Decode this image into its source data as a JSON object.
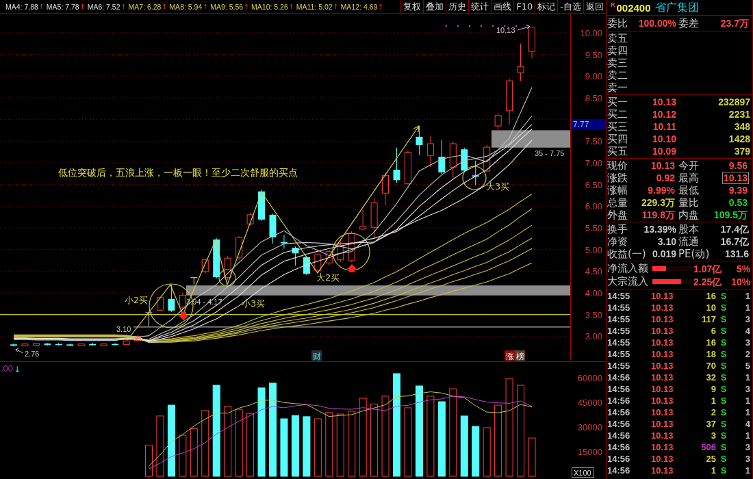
{
  "toolbar": {
    "ma_labels": [
      {
        "label": "MA4: 7.88",
        "arrow": "↑",
        "color": "#e0e0e0"
      },
      {
        "label": "MA5: 7.78",
        "arrow": "↑",
        "color": "#e0e0e0"
      },
      {
        "label": "MA6: 7.52",
        "arrow": "↑",
        "color": "#e0e0e0"
      },
      {
        "label": "MA7: 6.28",
        "arrow": "↑",
        "color": "#dcd44c"
      },
      {
        "label": "MA8: 5.94",
        "arrow": "↑",
        "color": "#dcd44c"
      },
      {
        "label": "MA9: 5.56",
        "arrow": "↑",
        "color": "#dcd44c"
      },
      {
        "label": "MA10: 5.26",
        "arrow": "↑",
        "color": "#dcd44c"
      },
      {
        "label": "MA11: 5.02",
        "arrow": "↑",
        "color": "#dcd44c"
      },
      {
        "label": "MA12: 4.69",
        "arrow": "↑",
        "color": "#dcd44c"
      }
    ],
    "buttons": [
      "复权",
      "叠加",
      "历史",
      "统计",
      "画线",
      "F10",
      "标记",
      "-自选",
      "返回"
    ]
  },
  "price_chart": {
    "price_tag": "7.77",
    "headline": "低位突破后，五浪上涨，一板一眼！至少二次舒服的买点",
    "buy_points": [
      "小2买",
      "小3买",
      "大2买",
      "大3买"
    ],
    "zone_labels": [
      "3.94 - 4.17",
      "35 - 7.75"
    ],
    "line_label": "3.10",
    "high_label": "10.13",
    "low_label": "2.76",
    "events": [
      {
        "text": "财",
        "kind": "finance"
      },
      {
        "text": "涨",
        "kind": "rise"
      },
      {
        "text": "榜",
        "kind": "rank"
      }
    ],
    "chart_data": {
      "type": "candlestick",
      "grid": true,
      "categories": [
        null,
        null,
        null,
        null,
        null,
        null,
        null,
        null,
        null,
        null,
        null,
        null,
        null,
        null,
        null,
        null,
        null,
        null,
        null,
        null,
        null,
        null,
        null,
        null,
        null,
        null,
        null,
        null,
        null,
        null,
        null,
        null,
        null,
        null,
        null,
        null,
        null,
        null,
        null,
        null,
        null,
        null,
        null,
        null,
        null,
        null,
        null
      ],
      "ohlc": [
        [
          2.81,
          2.83,
          2.76,
          2.78
        ],
        [
          2.78,
          2.83,
          2.77,
          2.82
        ],
        [
          2.79,
          2.84,
          2.78,
          2.83
        ],
        [
          2.83,
          2.84,
          2.78,
          2.8
        ],
        [
          2.82,
          2.84,
          2.78,
          2.8
        ],
        [
          2.81,
          2.83,
          2.77,
          2.78
        ],
        [
          2.78,
          2.83,
          2.77,
          2.82
        ],
        [
          2.82,
          2.84,
          2.78,
          2.79
        ],
        [
          2.78,
          2.83,
          2.77,
          2.82
        ],
        [
          2.82,
          2.84,
          2.78,
          2.8
        ],
        [
          2.81,
          2.9,
          2.8,
          2.89
        ],
        [
          2.9,
          3.02,
          2.88,
          2.99
        ],
        [
          3.54,
          3.54,
          3.23,
          3.54
        ],
        [
          3.6,
          3.92,
          3.57,
          3.89
        ],
        [
          3.86,
          4.19,
          3.56,
          3.59
        ],
        [
          3.67,
          4.0,
          3.62,
          3.94
        ],
        [
          4.35,
          4.35,
          4.19,
          4.35
        ],
        [
          4.49,
          4.79,
          4.44,
          4.76
        ],
        [
          5.23,
          5.26,
          4.33,
          4.36
        ],
        [
          4.35,
          4.85,
          4.3,
          4.8
        ],
        [
          4.82,
          5.31,
          4.76,
          5.28
        ],
        [
          5.59,
          5.85,
          5.55,
          5.8
        ],
        [
          6.34,
          6.38,
          5.66,
          5.69
        ],
        [
          5.8,
          5.83,
          5.14,
          5.28
        ],
        [
          5.17,
          5.34,
          5.02,
          5.14
        ],
        [
          5.04,
          5.07,
          4.63,
          4.91
        ],
        [
          4.82,
          4.85,
          4.41,
          4.44
        ],
        [
          4.52,
          4.91,
          4.47,
          4.88
        ],
        [
          4.69,
          4.99,
          4.63,
          4.95
        ],
        [
          4.76,
          5.23,
          4.71,
          5.1
        ],
        [
          4.74,
          5.42,
          4.71,
          5.37
        ],
        [
          5.47,
          5.91,
          5.45,
          5.53
        ],
        [
          5.51,
          6.18,
          5.25,
          6.08
        ],
        [
          6.3,
          6.78,
          6.02,
          6.71
        ],
        [
          6.84,
          7.35,
          6.54,
          6.6
        ],
        [
          6.52,
          7.28,
          6.49,
          7.24
        ],
        [
          7.6,
          7.85,
          7.17,
          7.41
        ],
        [
          7.17,
          7.61,
          6.9,
          7.44
        ],
        [
          7.14,
          7.52,
          6.75,
          6.78
        ],
        [
          6.9,
          7.49,
          6.64,
          7.44
        ],
        [
          7.31,
          7.35,
          6.79,
          6.82
        ],
        [
          6.71,
          7.05,
          6.48,
          6.68
        ],
        [
          6.81,
          7.41,
          6.78,
          7.36
        ],
        [
          7.85,
          8.15,
          7.76,
          8.09
        ],
        [
          8.2,
          8.94,
          7.88,
          8.89
        ],
        [
          9.08,
          9.75,
          8.89,
          9.22
        ],
        [
          9.57,
          10.13,
          9.41,
          10.13
        ]
      ],
      "series": [
        {
          "type": "line",
          "color": "#c0c0c0",
          "values": [
            2.92,
            2.92,
            2.91,
            2.91,
            2.91,
            2.9,
            2.9,
            2.9,
            2.9,
            2.9,
            2.95,
            2.98,
            3.01,
            3.2,
            3.38,
            3.62,
            3.85,
            4.02,
            4.19,
            4.45,
            4.7,
            4.94,
            5.18,
            5.31,
            5.43,
            5.26,
            5.09,
            4.98,
            4.86,
            4.91,
            4.95,
            5.18,
            5.4,
            5.73,
            6.06,
            6.44,
            6.81,
            6.95,
            7.09,
            7.14,
            7.18,
            7.1,
            7.02,
            7.3,
            7.57,
            8.16,
            8.74
          ]
        },
        {
          "type": "line",
          "color": "#c0c0c0",
          "values": [
            2.93,
            2.93,
            2.92,
            2.92,
            2.92,
            2.91,
            2.91,
            2.91,
            2.91,
            2.91,
            2.93,
            2.93,
            2.93,
            3.05,
            3.16,
            3.33,
            3.49,
            3.71,
            3.92,
            4.14,
            4.36,
            4.62,
            4.87,
            5.0,
            5.13,
            5.15,
            5.16,
            5.15,
            5.13,
            5.07,
            5.01,
            5.09,
            5.16,
            5.41,
            5.65,
            5.95,
            6.25,
            6.49,
            6.72,
            6.89,
            7.05,
            7.1,
            7.15,
            7.3,
            7.44,
            7.76,
            8.08
          ]
        },
        {
          "type": "line",
          "color": "#e0e0e0",
          "values": [
            2.94,
            2.94,
            2.93,
            2.93,
            2.93,
            2.92,
            2.92,
            2.92,
            2.92,
            2.92,
            2.93,
            2.92,
            2.9,
            3.0,
            3.09,
            3.23,
            3.36,
            3.54,
            3.71,
            3.93,
            4.14,
            4.39,
            4.64,
            4.79,
            4.93,
            4.99,
            5.04,
            5.08,
            5.11,
            5.13,
            5.15,
            5.16,
            5.17,
            5.32,
            5.46,
            5.73,
            5.99,
            6.21,
            6.43,
            6.62,
            6.8,
            6.93,
            7.05,
            7.23,
            7.41,
            7.65,
            7.88
          ]
        },
        {
          "type": "line",
          "color": "#e0e0e0",
          "values": [
            2.95,
            2.95,
            2.94,
            2.94,
            2.94,
            2.93,
            2.93,
            2.93,
            2.93,
            2.93,
            2.94,
            2.93,
            2.89,
            2.97,
            3.04,
            3.15,
            3.26,
            3.41,
            3.56,
            3.75,
            3.93,
            4.17,
            4.41,
            4.57,
            4.73,
            4.81,
            4.89,
            4.96,
            5.02,
            5.08,
            5.13,
            5.2,
            5.26,
            5.34,
            5.41,
            5.59,
            5.77,
            5.97,
            6.17,
            6.36,
            6.54,
            6.69,
            6.84,
            7.07,
            7.29,
            7.54,
            7.78
          ]
        },
        {
          "type": "line",
          "color": "#e0e0e0",
          "values": [
            2.96,
            2.96,
            2.95,
            2.95,
            2.95,
            2.94,
            2.94,
            2.94,
            2.94,
            2.94,
            2.95,
            2.94,
            2.87,
            2.93,
            2.99,
            3.08,
            3.17,
            3.29,
            3.4,
            3.55,
            3.7,
            3.9,
            4.1,
            4.26,
            4.42,
            4.54,
            4.65,
            4.73,
            4.81,
            4.91,
            5.0,
            5.09,
            5.17,
            5.31,
            5.45,
            5.57,
            5.69,
            5.8,
            5.9,
            6.04,
            6.18,
            6.34,
            6.5,
            6.73,
            6.96,
            7.24,
            7.52
          ]
        },
        {
          "type": "line",
          "color": "#c8c040",
          "values": [
            2.98,
            2.98,
            2.98,
            2.98,
            2.98,
            2.98,
            2.98,
            2.98,
            2.98,
            2.98,
            2.97,
            2.96,
            2.9,
            2.92,
            2.94,
            2.98,
            3.01,
            3.06,
            3.1,
            3.18,
            3.25,
            3.35,
            3.45,
            3.53,
            3.61,
            3.67,
            3.73,
            3.8,
            3.87,
            3.96,
            4.04,
            4.14,
            4.24,
            4.37,
            4.49,
            4.64,
            4.79,
            4.94,
            5.08,
            5.23,
            5.37,
            5.5,
            5.62,
            5.78,
            5.93,
            6.11,
            6.28
          ]
        },
        {
          "type": "line",
          "color": "#c8c040",
          "values": [
            2.99,
            2.99,
            2.99,
            2.99,
            2.99,
            2.99,
            2.99,
            2.99,
            2.99,
            2.99,
            2.98,
            2.97,
            2.89,
            2.91,
            2.92,
            2.95,
            2.97,
            3.02,
            3.06,
            3.13,
            3.19,
            3.28,
            3.36,
            3.43,
            3.49,
            3.55,
            3.6,
            3.66,
            3.72,
            3.79,
            3.86,
            3.95,
            4.03,
            4.14,
            4.25,
            4.38,
            4.51,
            4.63,
            4.75,
            4.88,
            5.0,
            5.12,
            5.24,
            5.41,
            5.57,
            5.76,
            5.94
          ]
        },
        {
          "type": "line",
          "color": "#c8c040",
          "values": [
            3.0,
            3.0,
            3.0,
            3.0,
            3.0,
            3.0,
            3.0,
            3.0,
            3.0,
            3.0,
            2.99,
            2.98,
            2.88,
            2.89,
            2.9,
            2.93,
            2.95,
            2.99,
            3.03,
            3.09,
            3.14,
            3.22,
            3.29,
            3.35,
            3.41,
            3.46,
            3.5,
            3.56,
            3.61,
            3.67,
            3.73,
            3.81,
            3.88,
            3.98,
            4.07,
            4.19,
            4.3,
            4.41,
            4.51,
            4.62,
            4.73,
            4.84,
            4.94,
            5.08,
            5.22,
            5.39,
            5.56
          ]
        },
        {
          "type": "line",
          "color": "#c8c040",
          "values": [
            3.01,
            3.01,
            3.01,
            3.01,
            3.01,
            3.01,
            3.01,
            3.01,
            3.01,
            3.01,
            3.0,
            2.98,
            2.87,
            2.88,
            2.89,
            2.91,
            2.93,
            2.97,
            3.0,
            3.05,
            3.1,
            3.17,
            3.23,
            3.29,
            3.34,
            3.38,
            3.42,
            3.47,
            3.52,
            3.57,
            3.62,
            3.69,
            3.76,
            3.85,
            3.93,
            4.03,
            4.13,
            4.23,
            4.32,
            4.42,
            4.51,
            4.61,
            4.7,
            4.83,
            4.95,
            5.11,
            5.26
          ]
        },
        {
          "type": "line",
          "color": "#c8c040",
          "values": [
            3.02,
            3.02,
            3.02,
            3.02,
            3.02,
            3.02,
            3.02,
            3.02,
            3.02,
            3.02,
            3.01,
            2.98,
            2.86,
            2.87,
            2.88,
            2.9,
            2.91,
            2.95,
            2.98,
            3.03,
            3.07,
            3.13,
            3.19,
            3.24,
            3.28,
            3.32,
            3.36,
            3.4,
            3.44,
            3.49,
            3.54,
            3.6,
            3.66,
            3.74,
            3.82,
            3.91,
            4.0,
            4.09,
            4.17,
            4.26,
            4.34,
            4.43,
            4.51,
            4.63,
            4.74,
            4.88,
            5.02
          ]
        },
        {
          "type": "line",
          "color": "#c8c040",
          "values": [
            3.03,
            3.03,
            3.03,
            3.03,
            3.03,
            3.03,
            3.03,
            3.03,
            3.03,
            3.03,
            3.02,
            2.98,
            2.85,
            2.86,
            2.86,
            2.88,
            2.89,
            2.92,
            2.95,
            2.99,
            3.03,
            3.08,
            3.13,
            3.17,
            3.21,
            3.24,
            3.27,
            3.31,
            3.35,
            3.39,
            3.43,
            3.48,
            3.53,
            3.6,
            3.66,
            3.74,
            3.81,
            3.89,
            3.96,
            4.04,
            4.11,
            4.18,
            4.25,
            4.35,
            4.44,
            4.57,
            4.69
          ]
        }
      ],
      "ref_lines": [
        {
          "axis": "y",
          "value": 3.5,
          "color": "#c8c800"
        },
        {
          "axis": "y",
          "value": 3.21,
          "color": "#a8a8a8"
        }
      ],
      "bands": [
        {
          "axis": "y",
          "from": 3.94,
          "to": 4.17,
          "color": "#8c8c8c"
        },
        {
          "axis": "y",
          "from": 7.35,
          "to": 7.75,
          "color": "#8c8c8c"
        }
      ],
      "ylim": [
        2.42,
        10.44
      ],
      "yticks": [
        {
          "value": 10,
          "label": "10.00"
        },
        {
          "value": 9.5,
          "label": "9.50"
        },
        {
          "value": 9,
          "label": "9.00"
        },
        {
          "value": 8.5,
          "label": "8.50"
        },
        {
          "value": 7.5,
          "label": "7.50"
        },
        {
          "value": 7,
          "label": "7.00"
        },
        {
          "value": 6.5,
          "label": "6.50"
        },
        {
          "value": 6,
          "label": "6.00"
        },
        {
          "value": 5.5,
          "label": "5.50"
        },
        {
          "value": 5,
          "label": "5.00"
        },
        {
          "value": 4.5,
          "label": "4.50"
        },
        {
          "value": 4,
          "label": "4.00"
        },
        {
          "value": 3.5,
          "label": "3.50"
        },
        {
          "value": 3,
          "label": "3.00"
        }
      ]
    }
  },
  "volume_chart": {
    "indicator": {
      "value": ".00",
      "arrow": "↓"
    },
    "unit": "X100",
    "chart_data": {
      "type": "bar",
      "categories": [
        null,
        null,
        null,
        null,
        null,
        null,
        null,
        null,
        null,
        null,
        null,
        null,
        null,
        null,
        null,
        null,
        null,
        null,
        null,
        null,
        null,
        null,
        null,
        null,
        null,
        null,
        null,
        null,
        null,
        null,
        null,
        null,
        null,
        null,
        null
      ],
      "series": [
        {
          "color": "#ff3c3c",
          "values": [
            19000,
            36700,
            null,
            25000,
            29000,
            40000,
            null,
            42500,
            40800,
            38300,
            null,
            null,
            null,
            null,
            null,
            35000,
            38800,
            37900,
            39600,
            47500,
            44000,
            48800,
            null,
            41700,
            null,
            48800,
            null,
            53300,
            null,
            null,
            29600,
            43300,
            59600,
            55400,
            23300
          ]
        },
        {
          "color": "#54fcfc",
          "values": [
            null,
            null,
            43300,
            null,
            null,
            null,
            55400,
            null,
            null,
            null,
            53800,
            56700,
            35000,
            37000,
            36300,
            null,
            null,
            null,
            null,
            null,
            null,
            null,
            62500,
            null,
            55000,
            null,
            45400,
            null,
            36700,
            30400,
            null,
            null,
            null,
            null,
            null
          ]
        },
        {
          "type": "line",
          "color": "#c8c840",
          "values": [
            6200,
            12900,
            21000,
            25400,
            30600,
            34800,
            38500,
            38400,
            41500,
            43400,
            46200,
            46400,
            44900,
            44200,
            43800,
            40000,
            36400,
            37000,
            37500,
            39800,
            41600,
            43600,
            48500,
            48900,
            50400,
            51400,
            50700,
            48800,
            47800,
            42900,
            39100,
            38700,
            39900,
            43700,
            42200
          ]
        },
        {
          "type": "line",
          "color": "#c840c8",
          "values": [
            4600,
            8000,
            12000,
            14200,
            16800,
            20500,
            25700,
            29700,
            33500,
            37000,
            40500,
            42500,
            41700,
            42900,
            43600,
            43100,
            41400,
            41000,
            40800,
            41800,
            40800,
            40000,
            42700,
            43200,
            45100,
            46500,
            47100,
            48700,
            48400,
            46700,
            45200,
            44700,
            44400,
            45800,
            42600
          ]
        }
      ],
      "ylim": [
        0,
        70000
      ],
      "yticks": [
        {
          "value": 15000,
          "label": "15000"
        },
        {
          "value": 30000,
          "label": "30000"
        },
        {
          "value": 45000,
          "label": "45000"
        },
        {
          "value": 60000,
          "label": "60000"
        }
      ]
    }
  },
  "quote": {
    "flag": "R",
    "code": "002400",
    "name": "省广集团",
    "order_ratio": {
      "ratio_label": "委比",
      "ratio": "100.00%",
      "diff_label": "委差",
      "diff": "23.7万"
    },
    "asks": [
      "卖五",
      "卖四",
      "卖三",
      "卖二",
      "卖一"
    ],
    "bids": [
      {
        "label": "买一",
        "price": "10.13",
        "volume": "232897"
      },
      {
        "label": "买二",
        "price": "10.12",
        "volume": "2231"
      },
      {
        "label": "买三",
        "price": "10.11",
        "volume": "348"
      },
      {
        "label": "买四",
        "price": "10.10",
        "volume": "1428"
      },
      {
        "label": "买五",
        "price": "10.09",
        "volume": "379"
      }
    ],
    "stats": [
      [
        {
          "label": "现价",
          "value": "10.13",
          "kind": "rise",
          "boxed": false
        },
        {
          "label": "今开",
          "value": "9.56",
          "kind": "rise",
          "boxed": false
        }
      ],
      [
        {
          "label": "涨跌",
          "value": "0.92",
          "kind": "rise",
          "boxed": false
        },
        {
          "label": "最高",
          "value": "10.13",
          "kind": "rise",
          "boxed": true
        }
      ],
      [
        {
          "label": "涨幅",
          "value": "9.99%",
          "kind": "rise",
          "boxed": false
        },
        {
          "label": "最低",
          "value": "9.39",
          "kind": "rise",
          "boxed": false
        }
      ],
      [
        {
          "label": "总量",
          "value": "229.3万",
          "kind": "volume",
          "boxed": false
        },
        {
          "label": "量比",
          "value": "0.53",
          "kind": "fall",
          "boxed": false
        }
      ],
      [
        {
          "label": "外盘",
          "value": "119.8万",
          "kind": "rise",
          "boxed": false
        },
        {
          "label": "内盘",
          "value": "109.5万",
          "kind": "fall",
          "boxed": false
        }
      ]
    ],
    "fundamentals": [
      [
        {
          "label": "换手",
          "value": "13.39%"
        },
        {
          "label": "股本",
          "value": "17.4亿"
        }
      ],
      [
        {
          "label": "净资",
          "value": "3.10"
        },
        {
          "label": "流通",
          "value": "16.7亿"
        }
      ],
      [
        {
          "label": "收益(一)",
          "value": "0.019"
        },
        {
          "label": "PE(动)",
          "value": "131.6"
        }
      ]
    ],
    "flows": [
      {
        "label": "净流入额",
        "level": 0.33,
        "amount": "1.07亿",
        "percent": "5%"
      },
      {
        "label": "大宗流入",
        "level": 0.7,
        "amount": "2.25亿",
        "percent": "10%"
      }
    ],
    "trades": [
      {
        "time": "14:55",
        "price": "10.13",
        "volume": "16",
        "side": "S",
        "count": "1",
        "large": false
      },
      {
        "time": "14:55",
        "price": "10.13",
        "volume": "10",
        "side": "S",
        "count": "1",
        "large": false
      },
      {
        "time": "14:55",
        "price": "10.13",
        "volume": "117",
        "side": "S",
        "count": "3",
        "large": false
      },
      {
        "time": "14:55",
        "price": "10.13",
        "volume": "6",
        "side": "S",
        "count": "4",
        "large": false
      },
      {
        "time": "14:55",
        "price": "10.13",
        "volume": "16",
        "side": "S",
        "count": "3",
        "large": false
      },
      {
        "time": "14:55",
        "price": "10.13",
        "volume": "18",
        "side": "S",
        "count": "2",
        "large": false
      },
      {
        "time": "14:55",
        "price": "10.13",
        "volume": "70",
        "side": "S",
        "count": "5",
        "large": false
      },
      {
        "time": "14:56",
        "price": "10.13",
        "volume": "32",
        "side": "S",
        "count": "1",
        "large": false
      },
      {
        "time": "14:56",
        "price": "10.13",
        "volume": "9",
        "side": "S",
        "count": "3",
        "large": false
      },
      {
        "time": "14:56",
        "price": "10.13",
        "volume": "1",
        "side": "S",
        "count": "1",
        "large": false
      },
      {
        "time": "14:56",
        "price": "10.13",
        "volume": "2",
        "side": "S",
        "count": "1",
        "large": false
      },
      {
        "time": "14:56",
        "price": "10.13",
        "volume": "37",
        "side": "S",
        "count": "4",
        "large": false
      },
      {
        "time": "14:56",
        "price": "10.13",
        "volume": "3",
        "side": "S",
        "count": "1",
        "large": false
      },
      {
        "time": "14:56",
        "price": "10.13",
        "volume": "506",
        "side": "S",
        "count": "3",
        "large": true
      },
      {
        "time": "14:56",
        "price": "10.13",
        "volume": "25",
        "side": "S",
        "count": "3",
        "large": false
      },
      {
        "time": "14:56",
        "price": "10.13",
        "volume": "1",
        "side": "S",
        "count": "1",
        "large": false
      }
    ]
  }
}
